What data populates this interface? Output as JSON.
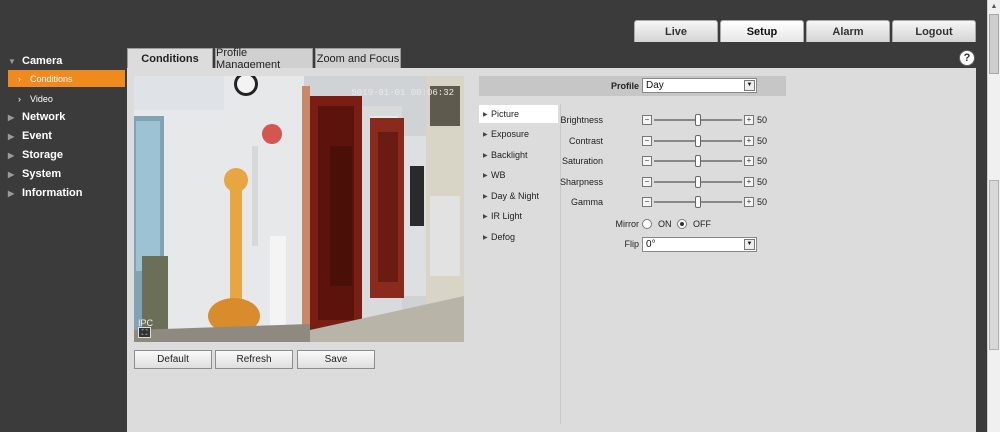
{
  "header": {
    "tabs": [
      {
        "label": "Live",
        "active": false
      },
      {
        "label": "Setup",
        "active": true
      },
      {
        "label": "Alarm",
        "active": false
      },
      {
        "label": "Logout",
        "active": false
      }
    ]
  },
  "sidebar": {
    "sections": [
      {
        "label": "Camera",
        "expanded": true,
        "icon": "triangle-down-icon"
      },
      {
        "label": "Network",
        "icon": "triangle-right-icon"
      },
      {
        "label": "Event",
        "icon": "triangle-right-icon"
      },
      {
        "label": "Storage",
        "icon": "triangle-right-icon"
      },
      {
        "label": "System",
        "icon": "triangle-right-icon"
      },
      {
        "label": "Information",
        "icon": "triangle-right-icon"
      }
    ],
    "camera_items": [
      {
        "label": "Conditions",
        "active": true
      },
      {
        "label": "Video",
        "active": false
      }
    ]
  },
  "main": {
    "tabs": [
      {
        "label": "Conditions",
        "active": true
      },
      {
        "label": "Profile Management",
        "active": false
      },
      {
        "label": "Zoom and Focus",
        "active": false
      }
    ],
    "help_icon": "?",
    "video": {
      "osd_time": "5019-01-01 00:06:32",
      "osd_channel": "IPC"
    },
    "buttons": {
      "default": "Default",
      "refresh": "Refresh",
      "save": "Save"
    },
    "profile": {
      "label": "Profile",
      "value": "Day"
    },
    "menu": [
      {
        "label": "Picture",
        "active": true
      },
      {
        "label": "Exposure"
      },
      {
        "label": "Backlight"
      },
      {
        "label": "WB"
      },
      {
        "label": "Day & Night"
      },
      {
        "label": "IR Light"
      },
      {
        "label": "Defog"
      }
    ],
    "sliders": [
      {
        "label": "Brightness",
        "value": "50",
        "level": 0.5
      },
      {
        "label": "Contrast",
        "value": "50",
        "level": 0.5
      },
      {
        "label": "Saturation",
        "value": "50",
        "level": 0.5
      },
      {
        "label": "Sharpness",
        "value": "50",
        "level": 0.5
      },
      {
        "label": "Gamma",
        "value": "50",
        "level": 0.5
      }
    ],
    "slider_minus": "−",
    "slider_plus": "+",
    "mirror": {
      "label": "Mirror",
      "on_label": "ON",
      "off_label": "OFF",
      "selected": "OFF"
    },
    "flip": {
      "label": "Flip",
      "value": "0°"
    }
  },
  "colors": {
    "accent": "#f08a1c",
    "header_bg": "#3b3b3b",
    "panel_bg": "#dcdcdc"
  }
}
